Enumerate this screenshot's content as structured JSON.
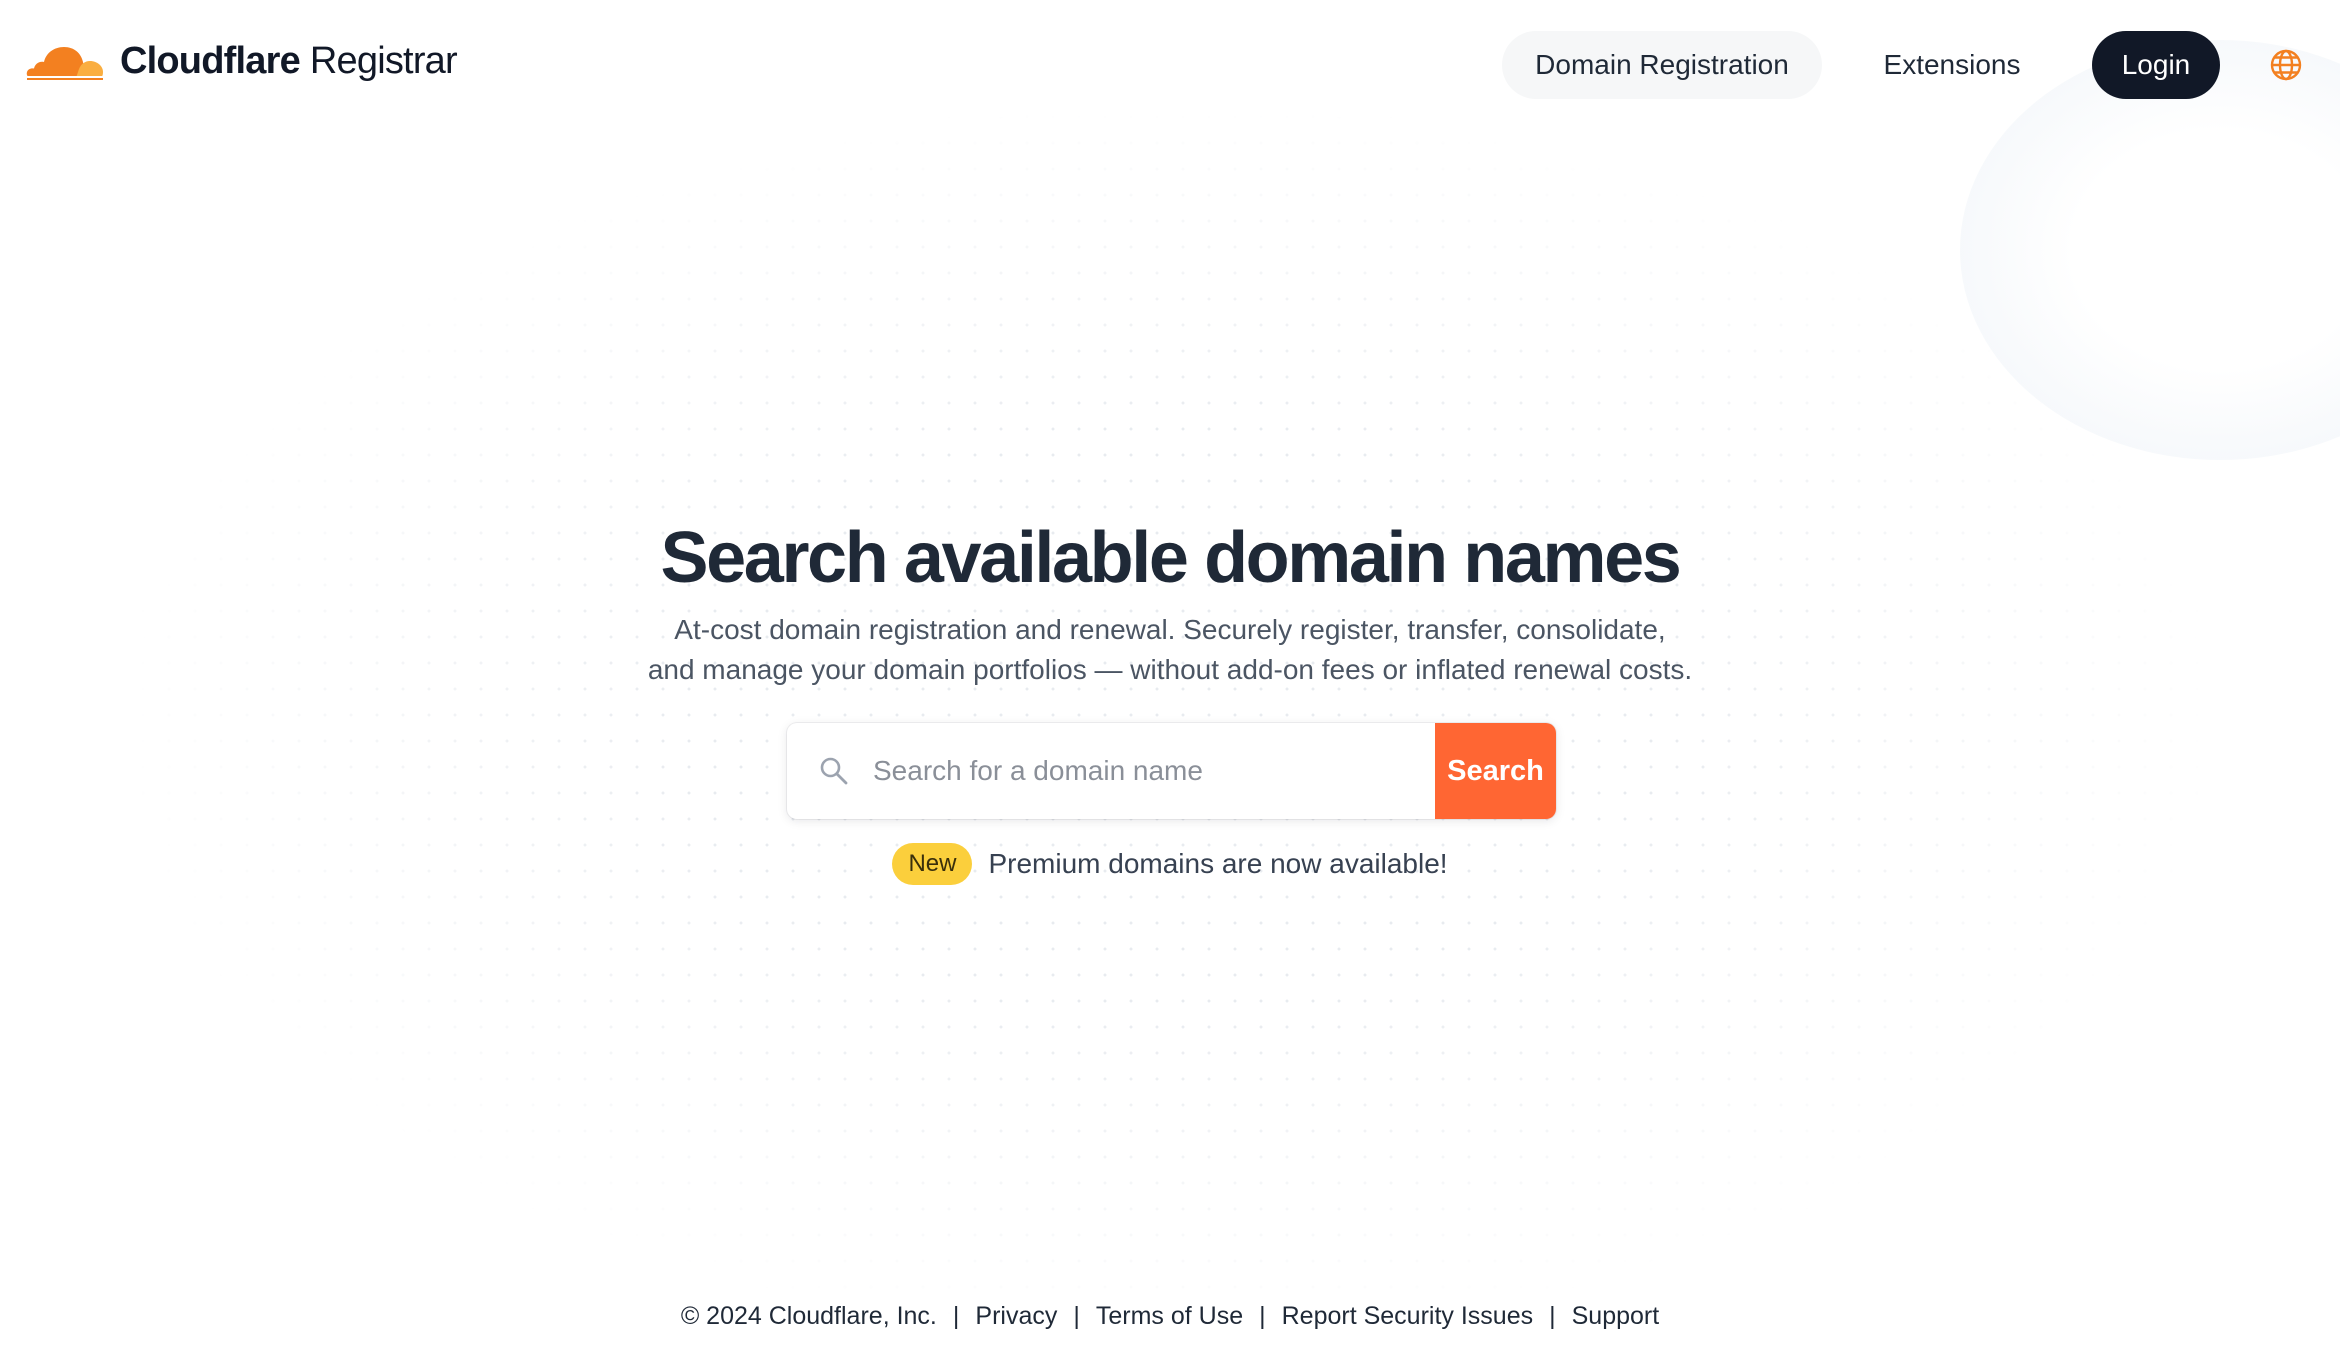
{
  "colors": {
    "brand_orange": "#f38020",
    "search_button": "#ff6633",
    "login_bg": "#111827",
    "badge_yellow": "#fbcf3c",
    "nav_pill_bg": "#f6f7f8"
  },
  "header": {
    "logo_icon": "cloudflare-cloud-icon",
    "brand_name": "Cloudflare",
    "product_name": "Registrar",
    "nav": {
      "domain_registration": "Domain Registration",
      "extensions": "Extensions",
      "login": "Login",
      "language_icon": "globe-icon"
    }
  },
  "hero": {
    "title": "Search available domain names",
    "subtitle_line1": "At-cost domain registration and renewal. Securely register, transfer, consolidate,",
    "subtitle_line2": "and manage your domain portfolios — without add-on fees or inflated renewal costs."
  },
  "search": {
    "icon": "search-icon",
    "value": "",
    "placeholder": "Search for a domain name",
    "button_label": "Search"
  },
  "announcement": {
    "badge": "New",
    "text": "Premium domains are now available!"
  },
  "footer": {
    "copyright": "© 2024 Cloudflare, Inc.",
    "separator": "|",
    "links": {
      "privacy": "Privacy",
      "terms": "Terms of Use",
      "security": "Report Security Issues",
      "support": "Support"
    }
  }
}
